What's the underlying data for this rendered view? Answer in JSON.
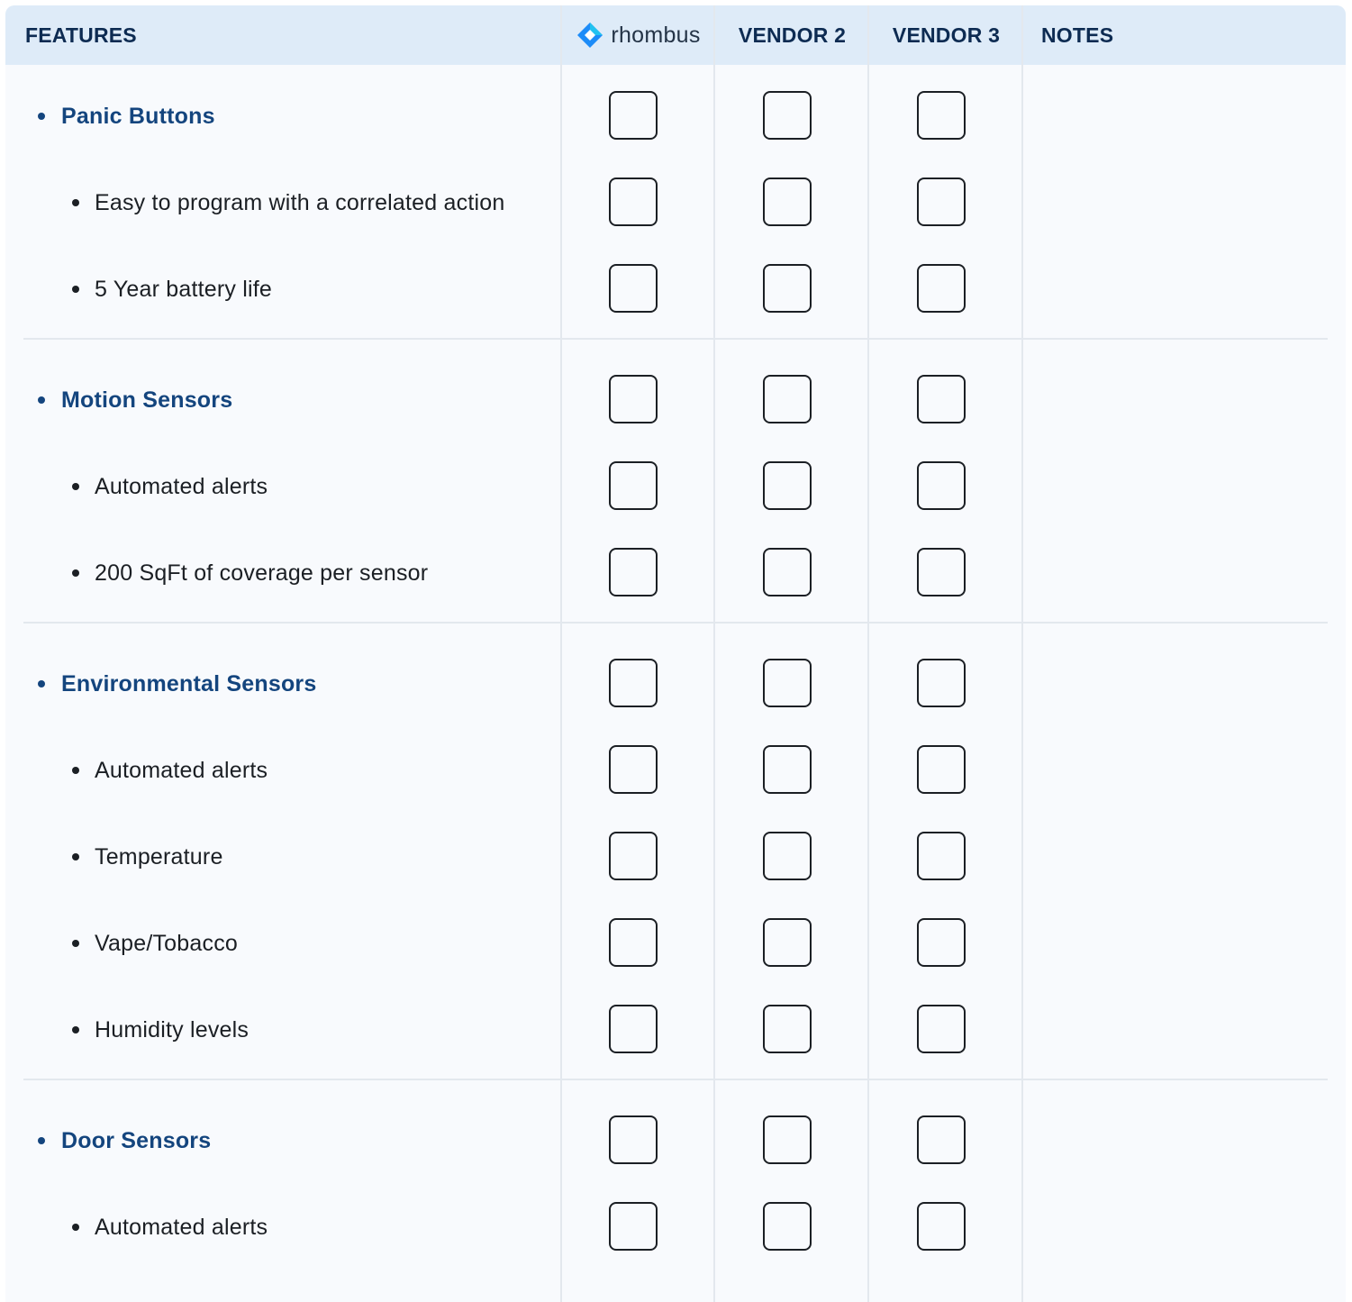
{
  "header": {
    "features": "FEATURES",
    "brand": "rhombus",
    "vendor2": "VENDOR 2",
    "vendor3": "VENDOR 3",
    "notes": "NOTES"
  },
  "icons": {
    "brand_logo": "rhombus-logo-icon"
  },
  "colors": {
    "header_bg": "#deebf8",
    "header_text": "#0d2b52",
    "category_text": "#14457e",
    "body_bg": "#f8fafd",
    "logo_primary": "#1d8cf8",
    "logo_secondary": "#22c2f0"
  },
  "sections": [
    {
      "title": "Panic Buttons",
      "items": [
        "Easy to program with a correlated action",
        "5 Year battery life"
      ]
    },
    {
      "title": "Motion Sensors",
      "items": [
        "Automated alerts",
        "200 SqFt of coverage per sensor"
      ]
    },
    {
      "title": "Environmental Sensors",
      "items": [
        "Automated alerts",
        "Temperature",
        "Vape/Tobacco",
        "Humidity levels"
      ]
    },
    {
      "title": "Door Sensors",
      "items": [
        "Automated alerts"
      ]
    }
  ]
}
